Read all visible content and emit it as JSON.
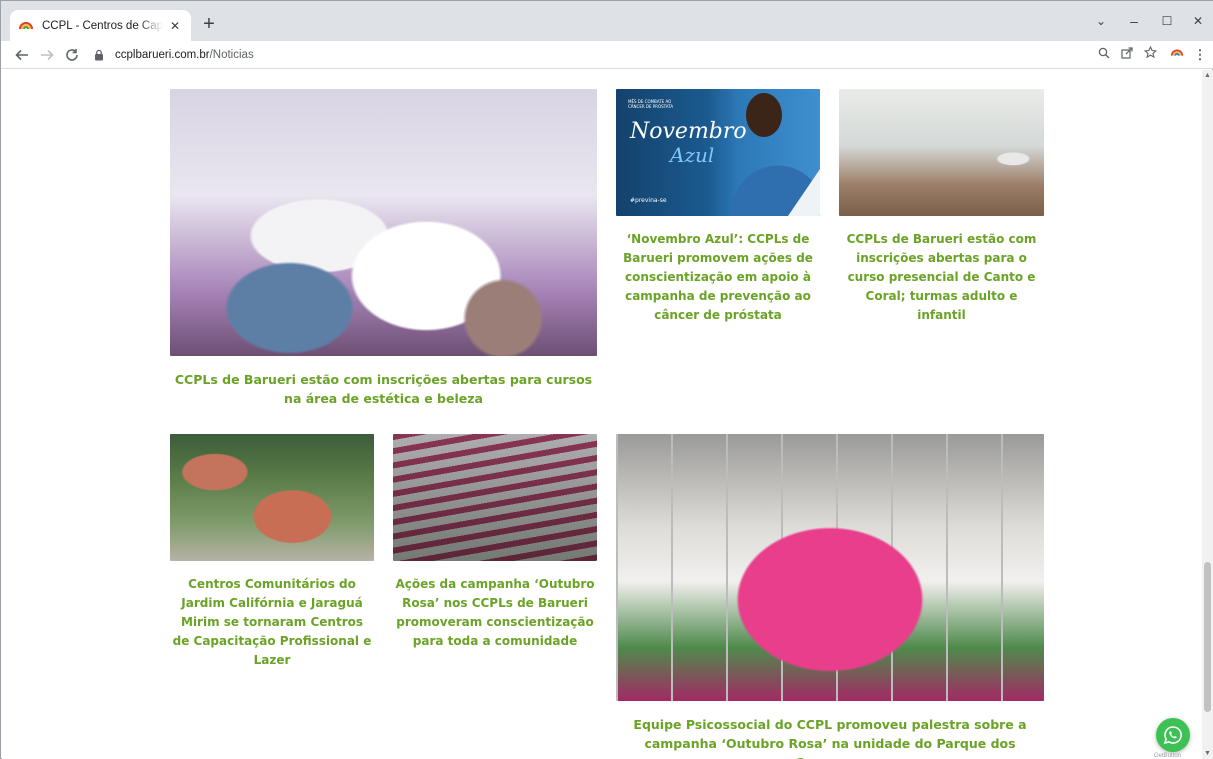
{
  "browser": {
    "tab_title": "CCPL - Centros de Capacitação P",
    "tab_close": "✕",
    "new_tab": "+",
    "url_host": "ccplbarueri.com.br",
    "url_path": "/Noticias",
    "win_min": "–",
    "win_max": "☐",
    "win_close": "✕",
    "win_chevron": "⌄"
  },
  "news": [
    {
      "caption": "CCPLs de Barueri estão com inscrições abertas para cursos na área de estética e beleza"
    },
    {
      "caption": "‘Novembro Azul’: CCPLs de Barueri promovem ações de conscientização em apoio à campanha de prevenção ao câncer de próstata",
      "overlay_title": "Novembro",
      "overlay_sub": "Azul",
      "overlay_small": "MÊS DE COMBATE AO CÂNCER DE PRÓSTATA",
      "overlay_tag": "#previna-se"
    },
    {
      "caption": "CCPLs de Barueri estão com inscrições abertas para o curso presencial de Canto e Coral; turmas adulto e infantil"
    },
    {
      "caption": "Centros Comunitários do Jardim Califórnia e Jaraguá Mirim se tornaram Centros de Capacitação Profissional e Lazer"
    },
    {
      "caption": "Ações da campanha ‘Outubro Rosa’ nos CCPLs de Barueri promoveram conscientização para toda a comunidade"
    },
    {
      "caption": "Equipe Psicossocial do CCPL promoveu palestra sobre a campanha ‘Outubro Rosa’ na unidade do Parque dos Camargos"
    }
  ],
  "whatsapp": {
    "label": "GetButton"
  },
  "colors": {
    "caption": "#6aa326",
    "whatsapp": "#3ec154"
  }
}
